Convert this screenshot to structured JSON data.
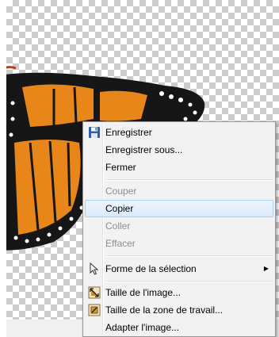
{
  "context_menu": {
    "items": [
      {
        "label": "Enregistrer",
        "enabled": true,
        "icon": "floppy-disk-icon"
      },
      {
        "label": "Enregistrer sous...",
        "enabled": true
      },
      {
        "label": "Fermer",
        "enabled": true
      },
      {
        "label": "Couper",
        "enabled": false
      },
      {
        "label": "Copier",
        "enabled": true,
        "highlighted": true
      },
      {
        "label": "Coller",
        "enabled": false
      },
      {
        "label": "Effacer",
        "enabled": false
      },
      {
        "label": "Forme de la sélection",
        "enabled": true,
        "icon": "cursor-arrow-icon",
        "submenu": true
      },
      {
        "label": "Taille de l'image...",
        "enabled": true,
        "icon": "image-size-icon"
      },
      {
        "label": "Taille de la zone de travail...",
        "enabled": true,
        "icon": "canvas-size-icon"
      },
      {
        "label": "Adapter l'image...",
        "enabled": true
      }
    ]
  },
  "colors": {
    "highlight_border": "#aecff7",
    "wing_orange": "#e8861a",
    "wing_black": "#161616"
  }
}
